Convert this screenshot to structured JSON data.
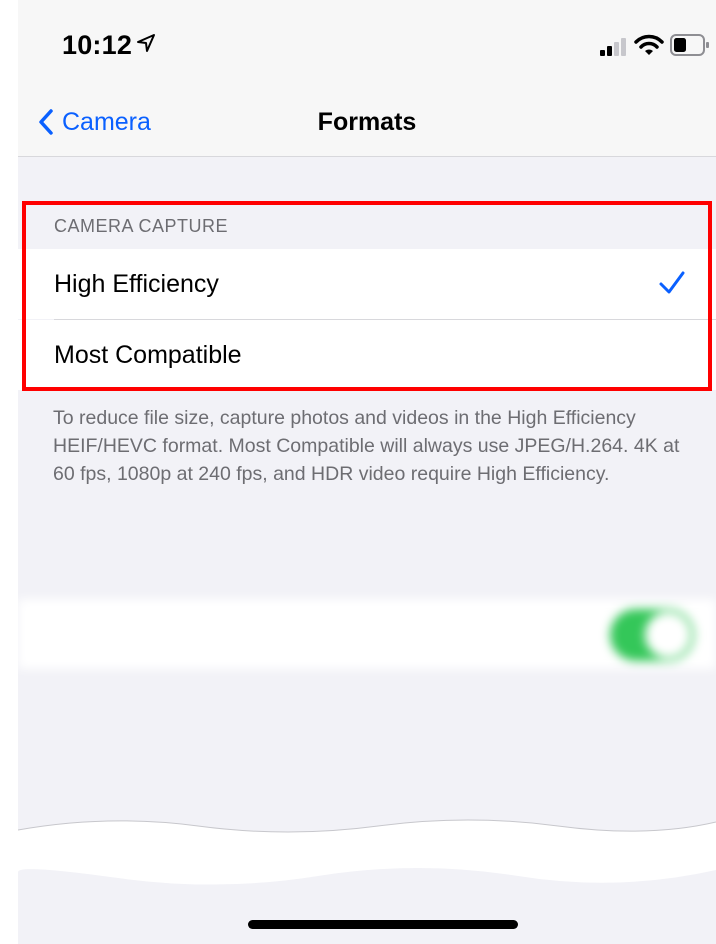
{
  "status_bar": {
    "time": "10:12",
    "icons": [
      "location-arrow-icon",
      "cellular-signal-icon",
      "wifi-icon",
      "battery-icon"
    ]
  },
  "nav": {
    "back_label": "Camera",
    "title": "Formats"
  },
  "camera_capture": {
    "header": "CAMERA CAPTURE",
    "options": [
      {
        "label": "High Efficiency",
        "selected": true
      },
      {
        "label": "Most Compatible",
        "selected": false
      }
    ],
    "footer": "To reduce file size, capture photos and videos in the High Efficiency HEIF/HEVC format. Most Compatible will always use JPEG/H.264. 4K at 60 fps, 1080p at 240 fps, and HDR video require High Efficiency."
  },
  "colors": {
    "accent": "#0a60ff",
    "highlight_border": "#ff0000",
    "toggle_on": "#34c759"
  }
}
